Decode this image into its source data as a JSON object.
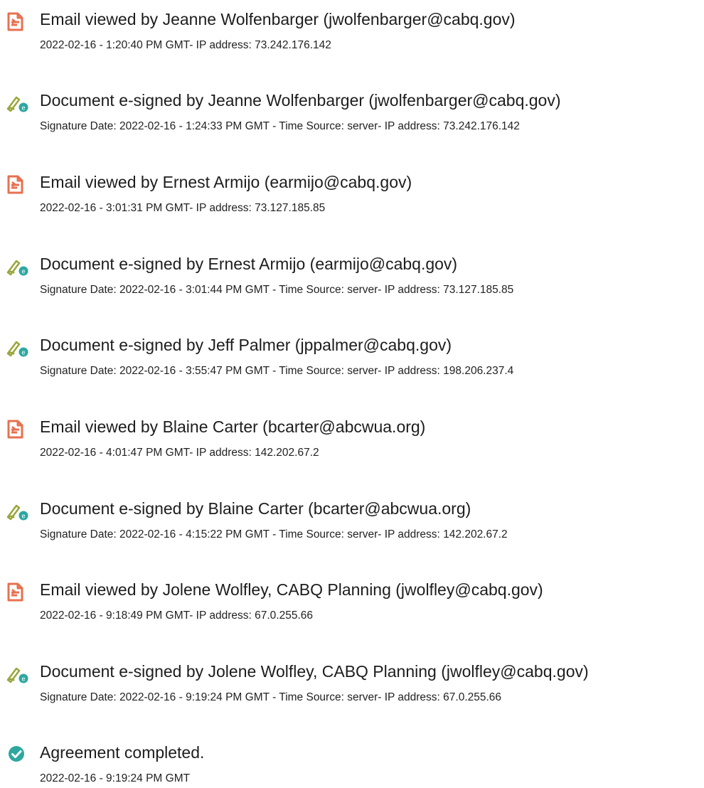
{
  "colors": {
    "email_icon": "#e8704f",
    "sign_icon_pen": "#9aa63a",
    "sign_icon_badge": "#2ea7a0",
    "completed_icon": "#2ea7a0",
    "text": "#1d1d1d"
  },
  "events": [
    {
      "icon": "email-viewed-icon",
      "title": "Email viewed by Jeanne Wolfenbarger (jwolfenbarger@cabq.gov)",
      "detail": "2022-02-16 - 1:20:40 PM GMT- IP address: 73.242.176.142"
    },
    {
      "icon": "document-signed-icon",
      "title": "Document e-signed by Jeanne Wolfenbarger (jwolfenbarger@cabq.gov)",
      "detail": "Signature Date: 2022-02-16 - 1:24:33 PM GMT - Time Source: server- IP address: 73.242.176.142"
    },
    {
      "icon": "email-viewed-icon",
      "title": "Email viewed by Ernest Armijo (earmijo@cabq.gov)",
      "detail": "2022-02-16 - 3:01:31 PM GMT- IP address: 73.127.185.85"
    },
    {
      "icon": "document-signed-icon",
      "title": "Document e-signed by Ernest Armijo (earmijo@cabq.gov)",
      "detail": "Signature Date: 2022-02-16 - 3:01:44 PM GMT - Time Source: server- IP address: 73.127.185.85"
    },
    {
      "icon": "document-signed-icon",
      "title": "Document e-signed by Jeff Palmer (jppalmer@cabq.gov)",
      "detail": "Signature Date: 2022-02-16 - 3:55:47 PM GMT - Time Source: server- IP address: 198.206.237.4"
    },
    {
      "icon": "email-viewed-icon",
      "title": "Email viewed by Blaine Carter (bcarter@abcwua.org)",
      "detail": "2022-02-16 - 4:01:47 PM GMT- IP address: 142.202.67.2"
    },
    {
      "icon": "document-signed-icon",
      "title": "Document e-signed by Blaine Carter (bcarter@abcwua.org)",
      "detail": "Signature Date: 2022-02-16 - 4:15:22 PM GMT - Time Source: server- IP address: 142.202.67.2"
    },
    {
      "icon": "email-viewed-icon",
      "title": "Email viewed by Jolene Wolfley, CABQ Planning (jwolfley@cabq.gov)",
      "detail": "2022-02-16 - 9:18:49 PM GMT- IP address: 67.0.255.66"
    },
    {
      "icon": "document-signed-icon",
      "title": "Document e-signed by Jolene Wolfley, CABQ Planning (jwolfley@cabq.gov)",
      "detail": "Signature Date: 2022-02-16 - 9:19:24 PM GMT - Time Source: server- IP address: 67.0.255.66"
    },
    {
      "icon": "agreement-completed-icon",
      "title": "Agreement completed.",
      "detail": "2022-02-16 - 9:19:24 PM GMT"
    }
  ]
}
